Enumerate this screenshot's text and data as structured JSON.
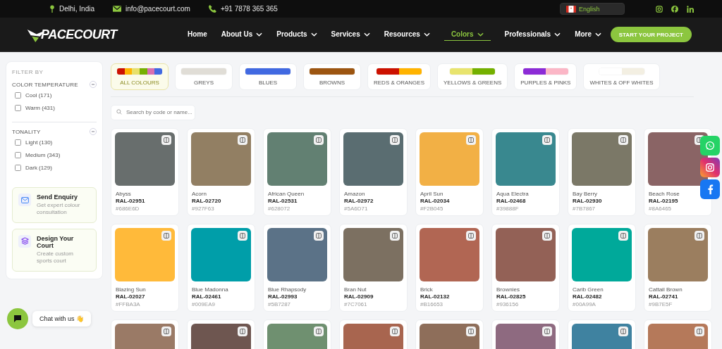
{
  "topbar": {
    "location": "Delhi, India",
    "email": "info@pacecourt.com",
    "phone": "+91 7878 365 365",
    "language": "English"
  },
  "nav": {
    "logo": "PACECOURT",
    "items": [
      {
        "label": "Home",
        "dropdown": false,
        "selected": false
      },
      {
        "label": "About Us",
        "dropdown": true,
        "selected": false
      },
      {
        "label": "Products",
        "dropdown": true,
        "selected": false
      },
      {
        "label": "Services",
        "dropdown": true,
        "selected": false
      },
      {
        "label": "Resources",
        "dropdown": true,
        "selected": false
      },
      {
        "label": "Colors",
        "dropdown": true,
        "selected": true
      },
      {
        "label": "Professionals",
        "dropdown": true,
        "selected": false
      },
      {
        "label": "More",
        "dropdown": true,
        "selected": false
      }
    ],
    "cta": "START YOUR PROJECT"
  },
  "sidebar": {
    "heading": "FILTER BY",
    "groups": [
      {
        "title": "COLOR TEMPERATURE",
        "options": [
          {
            "label": "Cool (171)",
            "checked": false
          },
          {
            "label": "Warm (431)",
            "checked": false
          }
        ]
      },
      {
        "title": "TONALITY",
        "options": [
          {
            "label": "Light (130)",
            "checked": false
          },
          {
            "label": "Medium (343)",
            "checked": false
          },
          {
            "label": "Dark (129)",
            "checked": false
          }
        ]
      }
    ],
    "cards": [
      {
        "kind": "enquiry",
        "title": "Send Enquiry",
        "subtitle": "Get expert colour consultation"
      },
      {
        "kind": "design",
        "title": "Design Your Court",
        "subtitle": "Create custom sports court"
      }
    ]
  },
  "categories": [
    {
      "label": "ALL COLOURS",
      "selected": true,
      "segments": [
        {
          "color": "#cc1100"
        },
        {
          "color": "#ffb300"
        },
        {
          "color": "#e8e06a"
        },
        {
          "color": "#76b000"
        },
        {
          "color": "#d86fb0"
        },
        {
          "color": "#4169e1"
        }
      ]
    },
    {
      "label": "GREYS",
      "selected": false,
      "segments": [
        {
          "color": "#e0ddd6"
        }
      ]
    },
    {
      "label": "BLUES",
      "selected": false,
      "segments": [
        {
          "color": "#4169e1"
        }
      ]
    },
    {
      "label": "BROWNS",
      "selected": false,
      "segments": [
        {
          "color": "#9c5510"
        }
      ]
    },
    {
      "label": "REDS & ORANGES",
      "selected": false,
      "segments": [
        {
          "color": "#cc1100"
        },
        {
          "color": "#ffb300"
        }
      ]
    },
    {
      "label": "YELLOWS & GREENS",
      "selected": false,
      "segments": [
        {
          "color": "#e8e46e"
        },
        {
          "color": "#74b000"
        }
      ]
    },
    {
      "label": "PURPLES & PINKS",
      "selected": false,
      "segments": [
        {
          "color": "#8c2bd6"
        },
        {
          "color": "#fbb6c6"
        }
      ]
    },
    {
      "label": "WHITES & OFF WHITES",
      "selected": false,
      "segments": [
        {
          "color": "#ffffff"
        },
        {
          "color": "#f3efe2"
        }
      ]
    }
  ],
  "search": {
    "placeholder": "Search by code or name..."
  },
  "swatches": [
    {
      "name": "Abyss",
      "code": "RAL-02951",
      "hex": "#686E6D",
      "color": "#686e6d"
    },
    {
      "name": "Acorn",
      "code": "RAL-02720",
      "hex": "#927F63",
      "color": "#927f63"
    },
    {
      "name": "African Queen",
      "code": "RAL-02531",
      "hex": "#628072",
      "color": "#628072"
    },
    {
      "name": "Amazon",
      "code": "RAL-02972",
      "hex": "#5A6D71",
      "color": "#5a6d71"
    },
    {
      "name": "April Sun",
      "code": "RAL-02034",
      "hex": "#F2B045",
      "color": "#f2b045"
    },
    {
      "name": "Aqua Electra",
      "code": "RAL-02468",
      "hex": "#39888F",
      "color": "#39888f"
    },
    {
      "name": "Bay Berry",
      "code": "RAL-02930",
      "hex": "#7B7867",
      "color": "#7b7867"
    },
    {
      "name": "Beach Rose",
      "code": "RAL-02195",
      "hex": "#8A6465",
      "color": "#8a6465"
    },
    {
      "name": "Blazing Sun",
      "code": "RAL-02027",
      "hex": "#FFBA3A",
      "color": "#ffba3a"
    },
    {
      "name": "Blue Madonna",
      "code": "RAL-02461",
      "hex": "#009EA9",
      "color": "#009ea9"
    },
    {
      "name": "Blue Rhapsody",
      "code": "RAL-02993",
      "hex": "#5B7287",
      "color": "#5b7287"
    },
    {
      "name": "Bran Nut",
      "code": "RAL-02909",
      "hex": "#7C7061",
      "color": "#7c7061"
    },
    {
      "name": "Brick",
      "code": "RAL-02132",
      "hex": "#B16653",
      "color": "#b16653"
    },
    {
      "name": "Brownies",
      "code": "RAL-02825",
      "hex": "#936156",
      "color": "#936156"
    },
    {
      "name": "Carib Green",
      "code": "RAL-02482",
      "hex": "#00A99A",
      "color": "#00a99a"
    },
    {
      "name": "Cattail Brown",
      "code": "RAL-02741",
      "hex": "#9B7E5F",
      "color": "#9b7e5f"
    },
    {
      "color": "#9a7a66"
    },
    {
      "color": "#6e5650"
    },
    {
      "color": "#6f9070"
    },
    {
      "color": "#a8654f"
    },
    {
      "color": "#8e6e5a"
    },
    {
      "color": "#8e6a80"
    },
    {
      "color": "#3f82a0"
    },
    {
      "color": "#b5795a"
    }
  ],
  "chat": {
    "label": "Chat with us 👋"
  }
}
